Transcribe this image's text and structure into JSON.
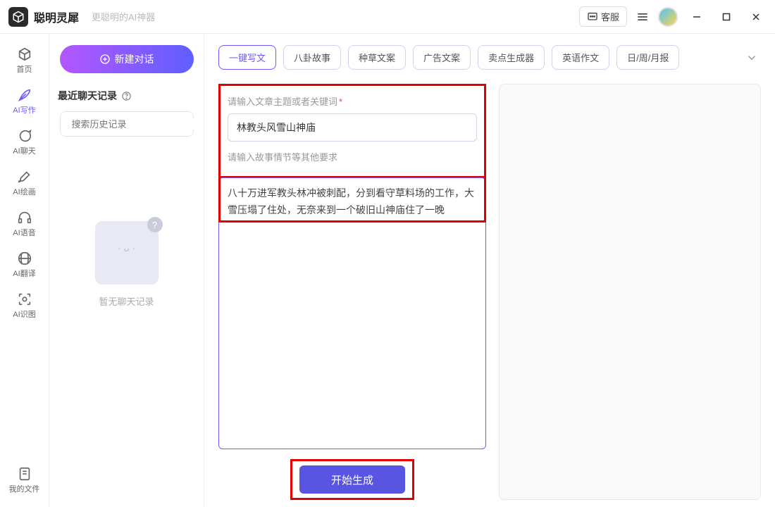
{
  "titlebar": {
    "app_name": "聪明灵犀",
    "tagline": "更聪明的AI神器",
    "customer_service": "客服"
  },
  "sidebar": {
    "items": [
      {
        "label": "首页"
      },
      {
        "label": "AI写作"
      },
      {
        "label": "AI聊天"
      },
      {
        "label": "AI绘画"
      },
      {
        "label": "AI语音"
      },
      {
        "label": "AI翻译"
      },
      {
        "label": "AI识图"
      }
    ],
    "footer": {
      "label": "我的文件"
    }
  },
  "col2": {
    "new_chat": "新建对话",
    "recent_title": "最近聊天记录",
    "search_placeholder": "搜索历史记录",
    "empty_text": "暂无聊天记录"
  },
  "tags": [
    "一键写文",
    "八卦故事",
    "种草文案",
    "广告文案",
    "卖点生成器",
    "英语作文",
    "日/周/月报"
  ],
  "form": {
    "label_topic": "请输入文章主题或者关键词",
    "topic_value": "林教头风雪山神庙",
    "label_detail": "请输入故事情节等其他要求",
    "detail_value": "八十万进军教头林冲被刺配，分到看守草料场的工作，大雪压塌了住处，无奈来到一个破旧山神庙住了一晚",
    "generate": "开始生成"
  }
}
